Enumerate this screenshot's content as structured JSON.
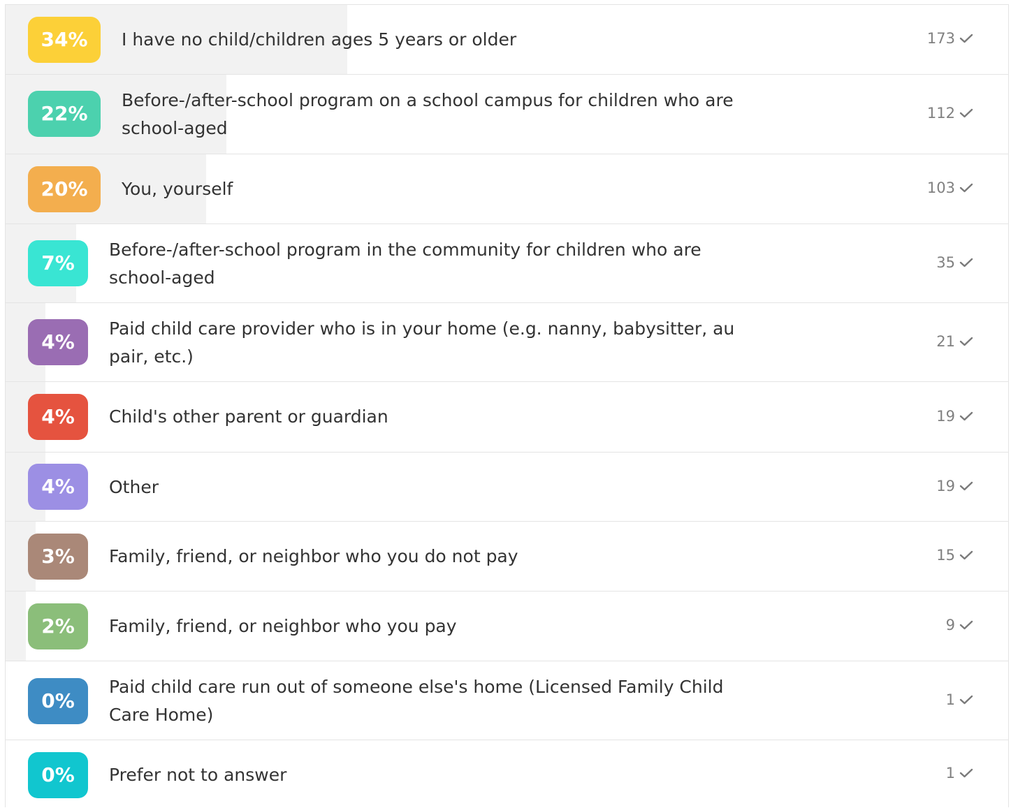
{
  "options": [
    {
      "percent": "34%",
      "fraction": 0.34,
      "color": "#FCD038",
      "label": "I have no child/children ages 5 years or older",
      "count": "173"
    },
    {
      "percent": "22%",
      "fraction": 0.22,
      "color": "#4CD1AE",
      "label": "Before-/after-school program on a school campus for children who are school-aged",
      "count": "112"
    },
    {
      "percent": "20%",
      "fraction": 0.2,
      "color": "#F3AE4E",
      "label": "You, yourself",
      "count": "103"
    },
    {
      "percent": "7%",
      "fraction": 0.07,
      "color": "#39E5D3",
      "label": "Before-/after-school program in the community for children who are school-aged",
      "count": "35"
    },
    {
      "percent": "4%",
      "fraction": 0.04,
      "color": "#9A6DB3",
      "label": "Paid child care provider who is in your home (e.g. nanny, babysitter, au pair, etc.)",
      "count": "21"
    },
    {
      "percent": "4%",
      "fraction": 0.04,
      "color": "#E5533F",
      "label": "Child's other parent or guardian",
      "count": "19"
    },
    {
      "percent": "4%",
      "fraction": 0.04,
      "color": "#9C8FE4",
      "label": "Other",
      "count": "19"
    },
    {
      "percent": "3%",
      "fraction": 0.03,
      "color": "#AA8878",
      "label": "Family, friend, or neighbor who you do not pay",
      "count": "15"
    },
    {
      "percent": "2%",
      "fraction": 0.02,
      "color": "#8BBE7A",
      "label": "Family, friend, or neighbor who you pay",
      "count": "9"
    },
    {
      "percent": "0%",
      "fraction": 0.0,
      "color": "#3E8CC4",
      "label": "Paid child care run out of someone else's home (Licensed Family Child Care Home)",
      "count": "1"
    },
    {
      "percent": "0%",
      "fraction": 0.0,
      "color": "#11C6CF",
      "label": "Prefer not to answer",
      "count": "1"
    }
  ],
  "icons": {
    "count_icon": "check-icon"
  }
}
